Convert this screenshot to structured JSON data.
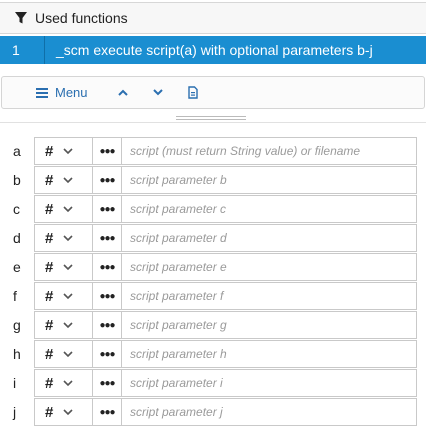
{
  "panel": {
    "title": "Used functions",
    "icon": "filter-icon"
  },
  "functions": [
    {
      "index": "1",
      "name": "_scm execute script(a) with optional parameters b-j",
      "selected": true
    }
  ],
  "toolbar": {
    "menu_label": "Menu",
    "icons": [
      "menu-icon",
      "chevron-up-icon",
      "chevron-down-icon",
      "document-icon"
    ]
  },
  "params": [
    {
      "label": "a",
      "type": "#",
      "value": "",
      "placeholder": "script (must return String value) or filename"
    },
    {
      "label": "b",
      "type": "#",
      "value": "",
      "placeholder": "script parameter b"
    },
    {
      "label": "c",
      "type": "#",
      "value": "",
      "placeholder": "script parameter c"
    },
    {
      "label": "d",
      "type": "#",
      "value": "",
      "placeholder": "script parameter d"
    },
    {
      "label": "e",
      "type": "#",
      "value": "",
      "placeholder": "script parameter e"
    },
    {
      "label": "f",
      "type": "#",
      "value": "",
      "placeholder": "script parameter f"
    },
    {
      "label": "g",
      "type": "#",
      "value": "",
      "placeholder": "script parameter g"
    },
    {
      "label": "h",
      "type": "#",
      "value": "",
      "placeholder": "script parameter h"
    },
    {
      "label": "i",
      "type": "#",
      "value": "",
      "placeholder": "script parameter i"
    },
    {
      "label": "j",
      "type": "#",
      "value": "",
      "placeholder": "script parameter j"
    }
  ],
  "colors": {
    "accent": "#1a8ed1",
    "link": "#2b6fb0"
  }
}
